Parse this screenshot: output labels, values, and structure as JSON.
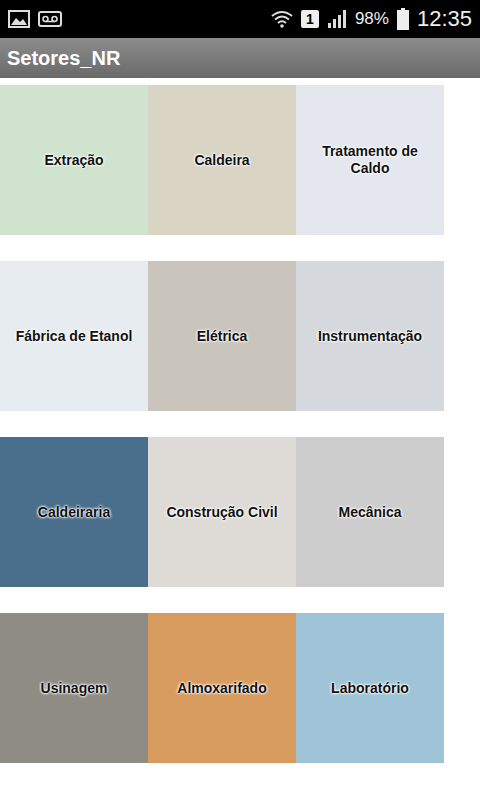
{
  "status_bar": {
    "sim": "1",
    "battery": "98%",
    "time": "12:35"
  },
  "app_bar": {
    "title": "Setores_NR"
  },
  "tiles": [
    {
      "label": "Extração",
      "color": "#cfe3cf"
    },
    {
      "label": "Caldeira",
      "color": "#d9d4c4"
    },
    {
      "label": "Tratamento de Caldo",
      "color": "#e4e8ee"
    },
    {
      "label": "Fábrica de Etanol",
      "color": "#e6ecef"
    },
    {
      "label": "Elétrica",
      "color": "#c9c4bc"
    },
    {
      "label": "Instrumentação",
      "color": "#d5d8dc"
    },
    {
      "label": "Caldeiraria",
      "color": "#4a6f8c"
    },
    {
      "label": "Construção Civil",
      "color": "#dedbd6"
    },
    {
      "label": "Mecânica",
      "color": "#cdcdcd"
    },
    {
      "label": "Usinagem",
      "color": "#8f8c86"
    },
    {
      "label": "Almoxarifado",
      "color": "#d79b5e"
    },
    {
      "label": "Laboratório",
      "color": "#9fc4d8"
    }
  ]
}
